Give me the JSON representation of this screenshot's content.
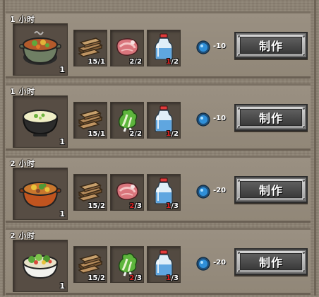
{
  "recipes": [
    {
      "time": "1 小时",
      "food_icon": "vegetable-stew-pot-icon",
      "food_qty": "1",
      "materials": [
        {
          "icon": "wood-planks-icon",
          "have": "15",
          "need": "1",
          "lacking": false
        },
        {
          "icon": "raw-meat-icon",
          "have": "2",
          "need": "2",
          "lacking": false
        },
        {
          "icon": "water-bottle-icon",
          "have": "1",
          "need": "2",
          "lacking": true
        }
      ],
      "cost": "-10",
      "button": "制作"
    },
    {
      "time": "1 小时",
      "food_icon": "vegetable-soup-bowl-icon",
      "food_qty": "1",
      "materials": [
        {
          "icon": "wood-planks-icon",
          "have": "15",
          "need": "1",
          "lacking": false
        },
        {
          "icon": "cabbage-icon",
          "have": "2",
          "need": "2",
          "lacking": false
        },
        {
          "icon": "water-bottle-icon",
          "have": "1",
          "need": "2",
          "lacking": true
        }
      ],
      "cost": "-10",
      "button": "制作"
    },
    {
      "time": "2 小时",
      "food_icon": "meat-stew-pot-icon",
      "food_qty": "1",
      "materials": [
        {
          "icon": "wood-planks-icon",
          "have": "15",
          "need": "2",
          "lacking": false
        },
        {
          "icon": "raw-meat-icon",
          "have": "2",
          "need": "3",
          "lacking": true
        },
        {
          "icon": "water-bottle-icon",
          "have": "1",
          "need": "3",
          "lacking": true
        }
      ],
      "cost": "-20",
      "button": "制作"
    },
    {
      "time": "2 小时",
      "food_icon": "salad-bowl-icon",
      "food_qty": "1",
      "materials": [
        {
          "icon": "wood-planks-icon",
          "have": "15",
          "need": "2",
          "lacking": false
        },
        {
          "icon": "cabbage-icon",
          "have": "2",
          "need": "3",
          "lacking": true
        },
        {
          "icon": "water-bottle-icon",
          "have": "1",
          "need": "3",
          "lacking": true
        }
      ],
      "cost": "-20",
      "button": "制作"
    }
  ],
  "colors": {
    "lacking": "#e02020",
    "sufficient": "#ffffff",
    "gem": "#2f8fd8"
  }
}
